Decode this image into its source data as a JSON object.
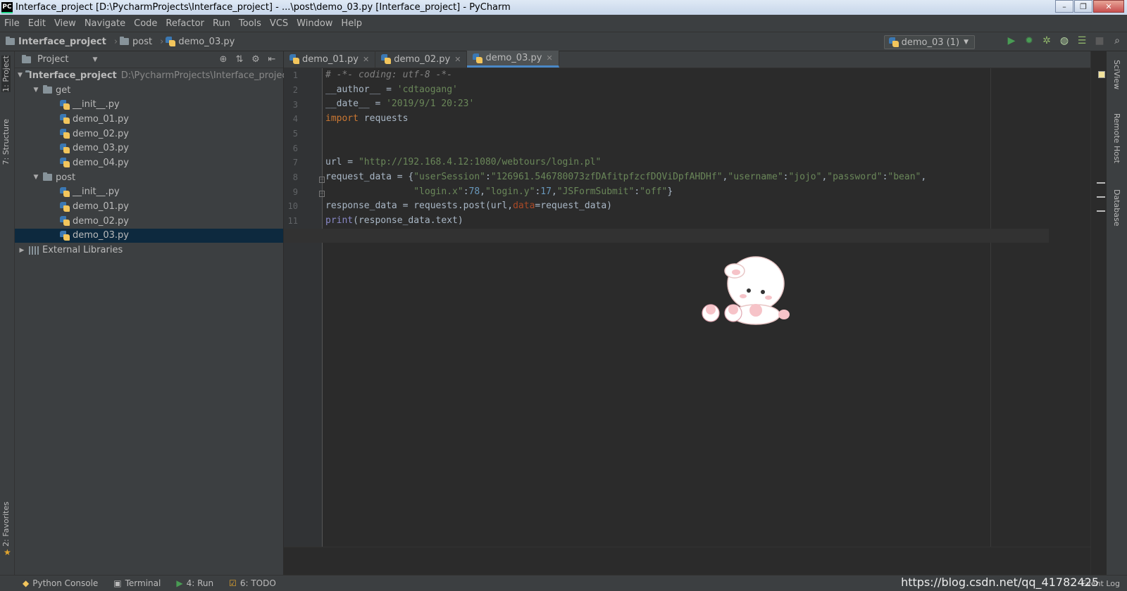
{
  "window": {
    "title": "Interface_project [D:\\PycharmProjects\\Interface_project] - ...\\post\\demo_03.py [Interface_project] - PyCharm",
    "logo": "PC",
    "controls": [
      "–",
      "❐",
      "✕"
    ]
  },
  "menu": [
    "File",
    "Edit",
    "View",
    "Navigate",
    "Code",
    "Refactor",
    "Run",
    "Tools",
    "VCS",
    "Window",
    "Help"
  ],
  "breadcrumb": {
    "project": "Interface_project",
    "folder": "post",
    "file": "demo_03.py"
  },
  "run_config": {
    "label": "demo_03 (1)",
    "icons": [
      "run-icon",
      "debug-icon",
      "coverage-icon",
      "profile-icon",
      "concurrency-icon",
      "stop-icon",
      "search-icon"
    ]
  },
  "left_tabs": {
    "project": "1: Project",
    "structure": "7: Structure",
    "favorites": "2: Favorites"
  },
  "project_panel": {
    "title": "Project",
    "tree": [
      {
        "label": "Interface_project",
        "path": "D:\\PycharmProjects\\Interface_project",
        "type": "folder",
        "expanded": true,
        "depth": 0
      },
      {
        "label": "get",
        "type": "folder",
        "expanded": true,
        "depth": 1
      },
      {
        "label": "__init__.py",
        "type": "py",
        "depth": 2
      },
      {
        "label": "demo_01.py",
        "type": "py",
        "depth": 2
      },
      {
        "label": "demo_02.py",
        "type": "py",
        "depth": 2
      },
      {
        "label": "demo_03.py",
        "type": "py",
        "depth": 2
      },
      {
        "label": "demo_04.py",
        "type": "py",
        "depth": 2
      },
      {
        "label": "post",
        "type": "folder",
        "expanded": true,
        "depth": 1
      },
      {
        "label": "__init__.py",
        "type": "py",
        "depth": 2
      },
      {
        "label": "demo_01.py",
        "type": "py",
        "depth": 2
      },
      {
        "label": "demo_02.py",
        "type": "py",
        "depth": 2
      },
      {
        "label": "demo_03.py",
        "type": "py",
        "depth": 2,
        "selected": true
      },
      {
        "label": "External Libraries",
        "type": "lib",
        "expanded": false,
        "depth": 0
      }
    ]
  },
  "editor": {
    "tabs": [
      {
        "label": "demo_01.py",
        "active": false
      },
      {
        "label": "demo_02.py",
        "active": false
      },
      {
        "label": "demo_03.py",
        "active": true
      }
    ],
    "lines": [
      "# -*- coding: utf-8 -*-",
      "__author__ = 'cdtaogang'",
      "__date__ = '2019/9/1 20:23'",
      "import requests",
      "",
      "",
      "url = \"http://192.168.4.12:1080/webtours/login.pl\"",
      "request_data = {\"userSession\":\"126961.546780073zfDAfitpfzcfDQViDpfAHDHf\",\"username\":\"jojo\",\"password\":\"bean\",",
      "                \"login.x\":78,\"login.y\":17,\"JSFormSubmit\":\"off\"}",
      "response_data = requests.post(url,data=request_data)",
      "print(response_data.text)",
      ""
    ]
  },
  "right_tabs": {
    "sciview": "SciView",
    "remote": "Remote Host",
    "database": "Database"
  },
  "statusbar": {
    "python_console": "Python Console",
    "terminal": "Terminal",
    "run": "4: Run",
    "todo": "6: TODO",
    "event_log": "Event Log"
  },
  "watermark": "https://blog.csdn.net/qq_41782425"
}
